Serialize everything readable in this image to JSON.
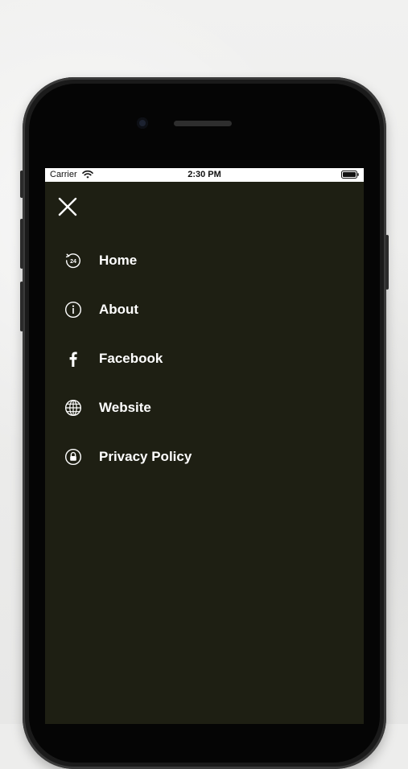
{
  "status_bar": {
    "carrier": "Carrier",
    "time": "2:30 PM"
  },
  "menu": {
    "items": [
      {
        "label": "Home",
        "icon": "home-24-icon"
      },
      {
        "label": "About",
        "icon": "info-icon"
      },
      {
        "label": "Facebook",
        "icon": "facebook-icon"
      },
      {
        "label": "Website",
        "icon": "globe-icon"
      },
      {
        "label": "Privacy Policy",
        "icon": "lock-icon"
      }
    ]
  },
  "colors": {
    "drawer_background": "#1e1f13",
    "text": "#ffffff",
    "status_bar_background": "#ffffff"
  }
}
